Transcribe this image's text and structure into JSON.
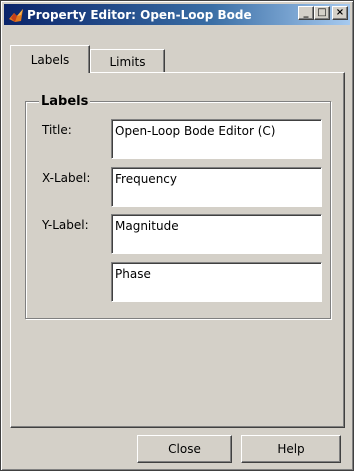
{
  "window": {
    "title": "Property Editor: Open-Loop Bode",
    "controls": {
      "minimize": "_",
      "maximize": "□",
      "close": "×"
    }
  },
  "tabs": [
    {
      "label": "Labels",
      "active": true
    },
    {
      "label": "Limits",
      "active": false
    }
  ],
  "labels_group": {
    "title": "Labels",
    "fields": {
      "title_label": "Title:",
      "title_value": "Open-Loop Bode Editor (C)",
      "xlabel_label": "X-Label:",
      "xlabel_value": "Frequency",
      "ylabel_label": "Y-Label:",
      "ylabel_value_1": "Magnitude",
      "ylabel_value_2": "Phase"
    }
  },
  "buttons": {
    "close": "Close",
    "help": "Help"
  },
  "colors": {
    "titlebar_start": "#0a246a",
    "titlebar_end": "#a6caf0",
    "dialog_bg": "#d4d0c8"
  }
}
